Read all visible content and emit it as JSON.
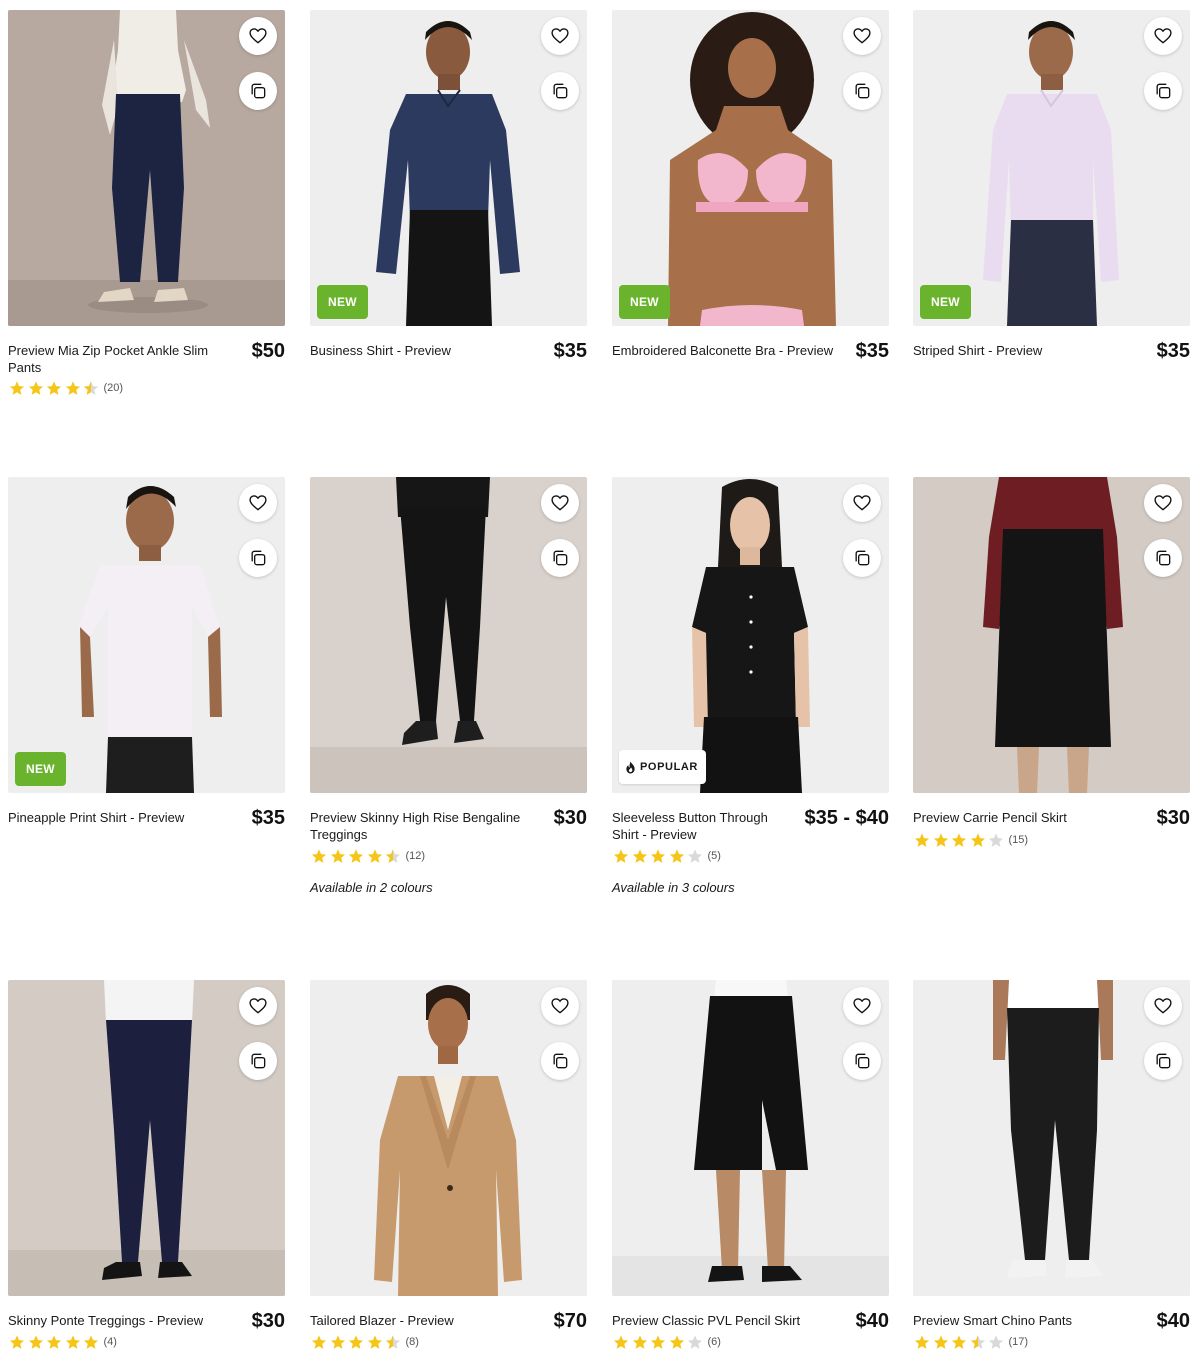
{
  "colors": {
    "new_badge": "#6ab42d",
    "star": "#f5c518",
    "star_empty": "#d9d9d9",
    "text": "#1a1a1a"
  },
  "icons": {
    "favourite": "heart-icon",
    "quick_view": "copy-icon",
    "popular": "flame-icon",
    "rating": "star-icon"
  },
  "products": [
    {
      "name": "Preview Mia Zip Pocket Ankle Slim Pants",
      "price": "$50",
      "rating": 4.5,
      "reviews": "(20)",
      "badge": "",
      "colours": ""
    },
    {
      "name": "Business Shirt - Preview",
      "price": "$35",
      "rating": null,
      "reviews": "",
      "badge": "NEW",
      "colours": ""
    },
    {
      "name": "Embroidered Balconette Bra - Preview",
      "price": "$35",
      "rating": null,
      "reviews": "",
      "badge": "NEW",
      "colours": ""
    },
    {
      "name": "Striped Shirt - Preview",
      "price": "$35",
      "rating": null,
      "reviews": "",
      "badge": "NEW",
      "colours": ""
    },
    {
      "name": "Pineapple Print Shirt - Preview",
      "price": "$35",
      "rating": null,
      "reviews": "",
      "badge": "NEW",
      "colours": ""
    },
    {
      "name": "Preview Skinny High Rise Bengaline Treggings",
      "price": "$30",
      "rating": 4.5,
      "reviews": "(12)",
      "badge": "",
      "colours": "Available in 2 colours"
    },
    {
      "name": "Sleeveless Button Through Shirt - Preview",
      "price": "$35 - $40",
      "rating": 4,
      "reviews": "(5)",
      "badge": "POPULAR",
      "colours": "Available in 3 colours"
    },
    {
      "name": "Preview Carrie Pencil Skirt",
      "price": "$30",
      "rating": 4,
      "reviews": "(15)",
      "badge": "",
      "colours": ""
    },
    {
      "name": "Skinny Ponte Treggings - Preview",
      "price": "$30",
      "rating": 5,
      "reviews": "(4)",
      "badge": "",
      "colours": ""
    },
    {
      "name": "Tailored Blazer - Preview",
      "price": "$70",
      "rating": 4.5,
      "reviews": "(8)",
      "badge": "",
      "colours": ""
    },
    {
      "name": "Preview Classic PVL Pencil Skirt",
      "price": "$40",
      "rating": 4,
      "reviews": "(6)",
      "badge": "",
      "colours": ""
    },
    {
      "name": "Preview Smart Chino Pants",
      "price": "$40",
      "rating": 3.5,
      "reviews": "(17)",
      "badge": "",
      "colours": ""
    }
  ]
}
